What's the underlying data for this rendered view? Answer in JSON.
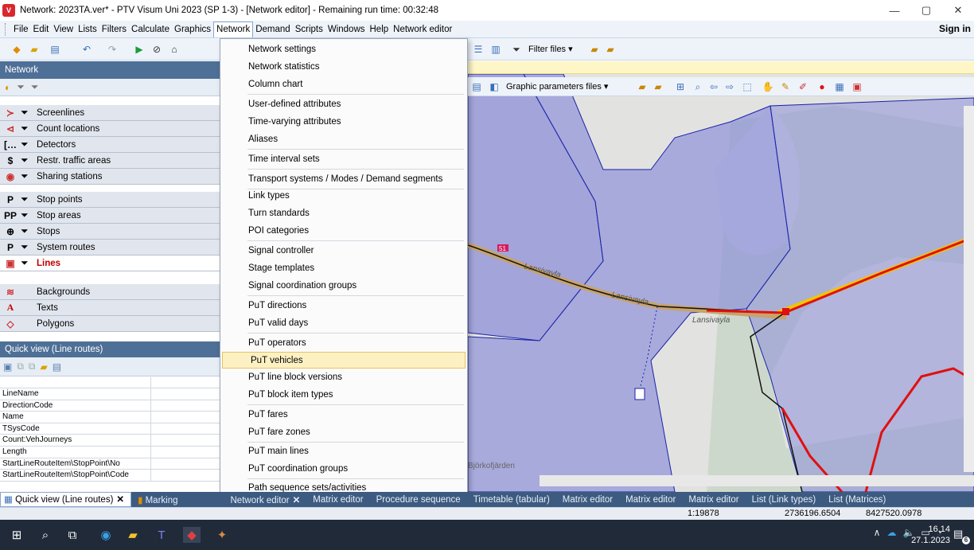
{
  "window": {
    "title": "Network: 2023TA.ver* - PTV Visum Uni 2023 (SP 1-3) - [Network editor] - Remaining run time: 00:32:48",
    "minimize": "—",
    "restore": "▢",
    "close": "✕"
  },
  "menubar": {
    "items": [
      "File",
      "Edit",
      "View",
      "Lists",
      "Filters",
      "Calculate",
      "Graphics",
      "Network",
      "Demand",
      "Scripts",
      "Windows",
      "Help",
      "Network editor"
    ],
    "active": "Network",
    "sign_in": "Sign in"
  },
  "toolbar": {
    "filter_files": "Filter files ▾"
  },
  "map_toolbar": {
    "graphic_parameters_files": "Graphic parameters files ▾"
  },
  "network_panel": {
    "title": "Network",
    "layers": [
      {
        "icon": "≻",
        "label": "Screenlines"
      },
      {
        "icon": "⊲",
        "label": "Count locations"
      },
      {
        "icon": "[…",
        "label": "Detectors"
      },
      {
        "icon": "$",
        "label": "Restr. traffic areas"
      },
      {
        "icon": "◉",
        "label": "Sharing stations"
      },
      {
        "icon": "P",
        "label": "Stop points"
      },
      {
        "icon": "PP",
        "label": "Stop areas"
      },
      {
        "icon": "⊕",
        "label": "Stops"
      },
      {
        "icon": "P",
        "label": "System routes"
      },
      {
        "icon": "▣",
        "label": "Lines"
      },
      {
        "icon": "≋",
        "label": "Backgrounds"
      },
      {
        "icon": "A",
        "label": "Texts"
      },
      {
        "icon": "◇",
        "label": "Polygons"
      }
    ]
  },
  "quick_view": {
    "title": "Quick view (Line routes)",
    "rows": [
      "LineName",
      "DirectionCode",
      "Name",
      "TSysCode",
      "Count:VehJourneys",
      "Length",
      "StartLineRouteItem\\StopPoint\\No",
      "StartLineRouteItem\\StopPoint\\Code"
    ]
  },
  "network_menu": {
    "items": [
      "Network settings",
      "Network statistics",
      "Column chart",
      "User-defined attributes",
      "Time-varying attributes",
      "Aliases",
      "Time interval sets",
      "Transport systems / Modes / Demand segments",
      "Link types",
      "Turn standards",
      "POI categories",
      "Signal controller",
      "Stage templates",
      "Signal coordination groups",
      "PuT directions",
      "PuT valid days",
      "PuT operators",
      "PuT vehicles",
      "PuT line block versions",
      "PuT block item types",
      "PuT fares",
      "PuT fare zones",
      "PuT main lines",
      "PuT coordination groups",
      "Path sequence sets/activities"
    ],
    "highlighted": "PuT vehicles"
  },
  "map": {
    "labels": {
      "road_badge": "51",
      "street1": "Lansivayla",
      "street2": "Lansivayla",
      "street3": "Lansivayla",
      "area": "Björkofjärden"
    }
  },
  "tabs": {
    "quick_view": "Quick view (Line routes)",
    "marking": "Marking",
    "network_editor": "Network editor",
    "matrix_editor": "Matrix editor",
    "procedure_sequence": "Procedure sequence",
    "timetable": "Timetable (tabular)",
    "matrix_editor2": "Matrix editor",
    "matrix_editor3": "Matrix editor",
    "matrix_editor4": "Matrix editor",
    "list_link_types": "List (Link types)",
    "list_matrices": "List (Matrices)"
  },
  "statusbar": {
    "scale": "1:19878",
    "x": "2736196.6504",
    "y": "8427520.0978"
  },
  "taskbar": {
    "time": "16.14",
    "date": "27.1.2023",
    "notifications": "6"
  }
}
